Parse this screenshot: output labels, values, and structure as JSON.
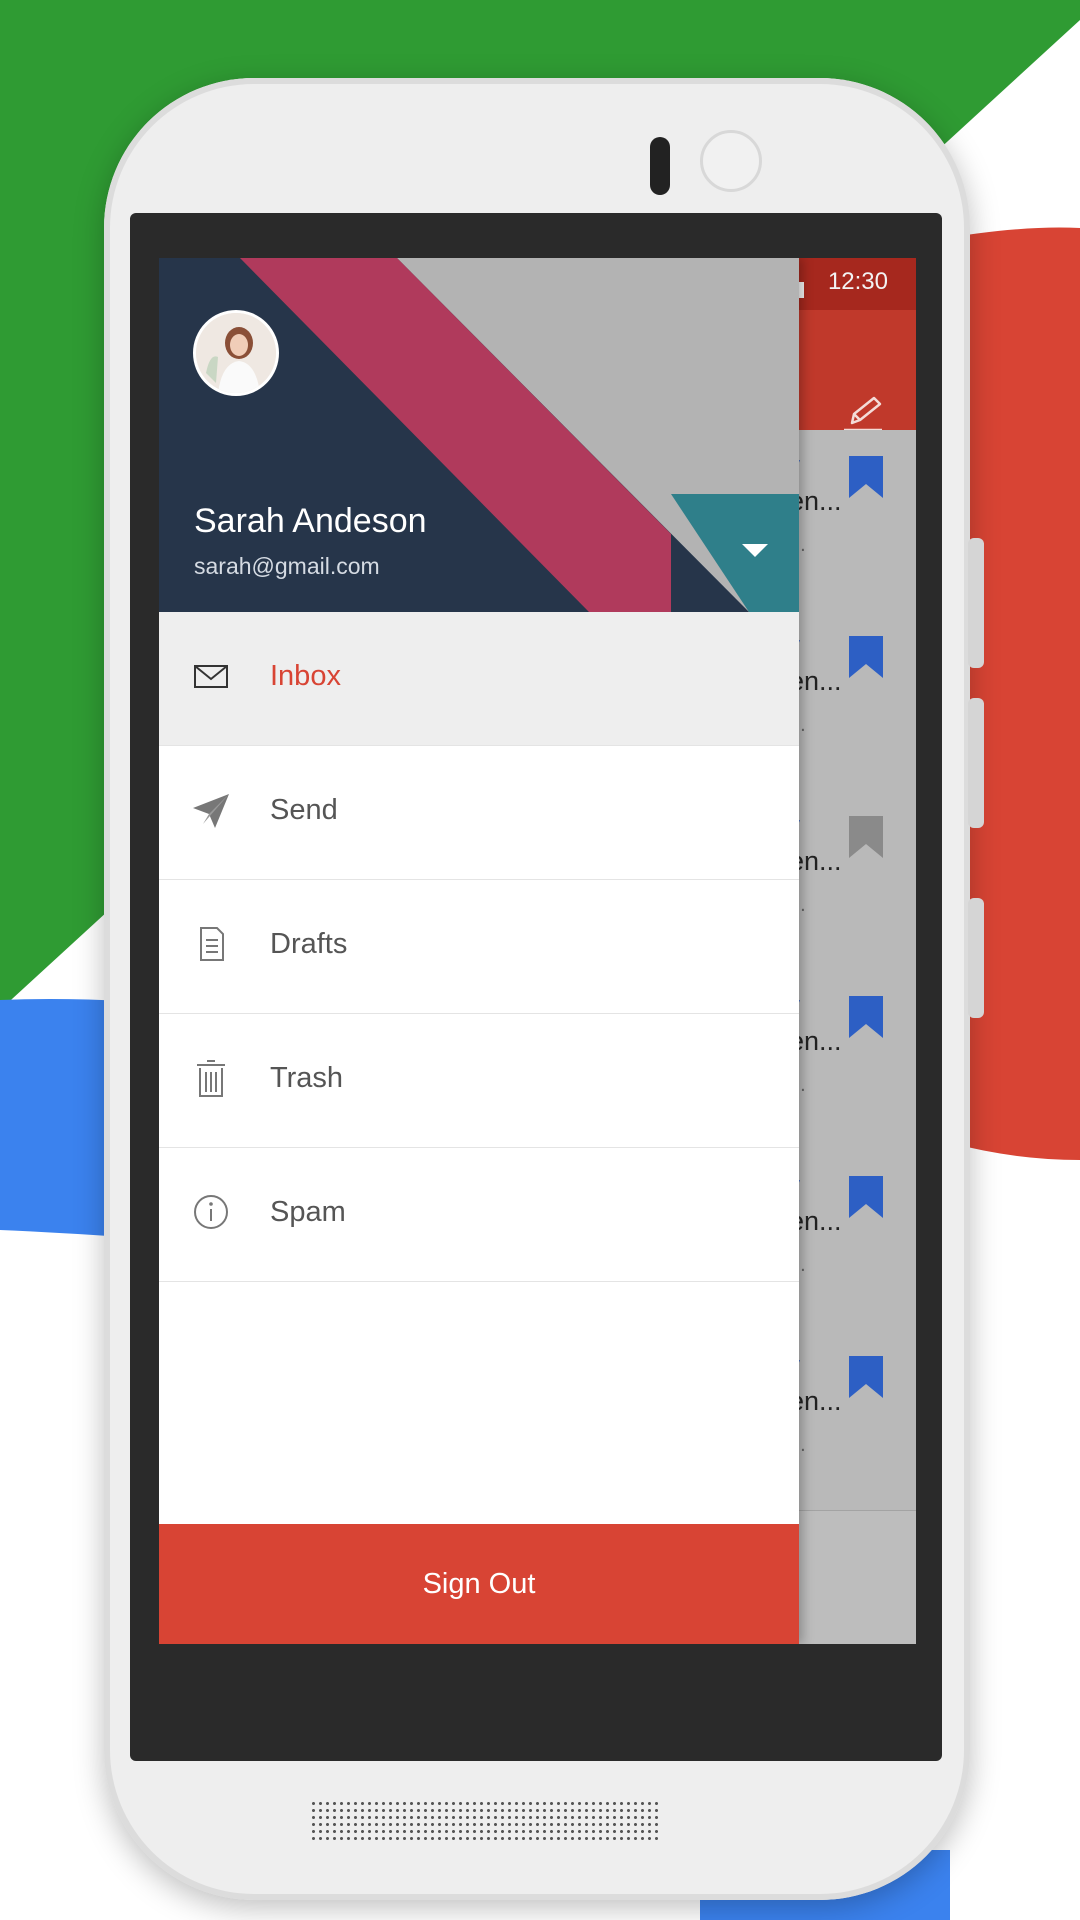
{
  "status_bar": {
    "time": "12:30"
  },
  "profile": {
    "name": "Sarah Andeson",
    "email": "sarah@gmail.com"
  },
  "menu": [
    {
      "label": "Inbox",
      "active": true,
      "icon": "mail-icon"
    },
    {
      "label": "Send",
      "active": false,
      "icon": "paper-plane-icon"
    },
    {
      "label": "Drafts",
      "active": false,
      "icon": "document-icon"
    },
    {
      "label": "Trash",
      "active": false,
      "icon": "trash-icon"
    },
    {
      "label": "Spam",
      "active": false,
      "icon": "info-icon"
    }
  ],
  "sign_out_label": "Sign Out",
  "background_list": [
    {
      "from": "y",
      "subject": "en...",
      "preview": "...",
      "bookmarked": true
    },
    {
      "from": "y",
      "subject": "en...",
      "preview": "...",
      "bookmarked": true
    },
    {
      "from": "y",
      "subject": "en...",
      "preview": "...",
      "bookmarked": false
    },
    {
      "from": "y",
      "subject": "en...",
      "preview": "...",
      "bookmarked": true
    },
    {
      "from": "y",
      "subject": "en...",
      "preview": "...",
      "bookmarked": true
    },
    {
      "from": "y",
      "subject": "en...",
      "preview": "...",
      "bookmarked": true
    }
  ],
  "colors": {
    "accent": "#d84434",
    "header_dark": "#26354a",
    "stripe_pink": "#b03a5c",
    "stripe_teal": "#2f7f8a",
    "app_bar": "#c0392b",
    "bookmark_blue": "#2d5fc4",
    "bookmark_gray": "#8a8a8a",
    "bg_green": "#2f9b33",
    "bg_red": "#d84434",
    "bg_blue": "#3b82ee"
  }
}
